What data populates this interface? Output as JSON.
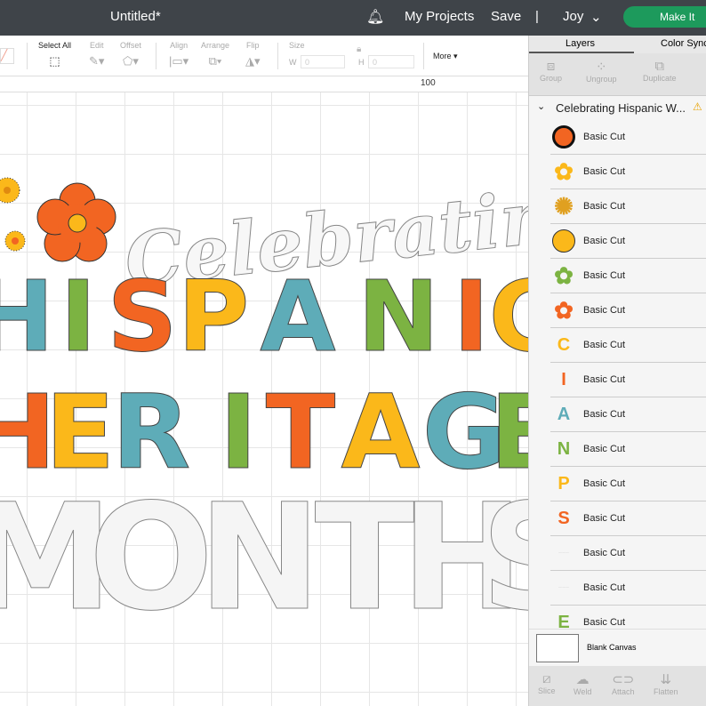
{
  "header": {
    "title": "Untitled*",
    "my_projects": "My Projects",
    "save": "Save",
    "divider": "|",
    "user": "Joy",
    "make_it": "Make It"
  },
  "toolbar": {
    "select_all": "Select All",
    "edit": "Edit",
    "offset": "Offset",
    "align": "Align",
    "arrange": "Arrange",
    "flip": "Flip",
    "size": "Size",
    "w_label": "W",
    "w_value": "0",
    "h_label": "H",
    "h_value": "0",
    "more": "More ▾"
  },
  "ruler": {
    "mark": "100"
  },
  "design": {
    "line1": "Celebrating",
    "line2": [
      "H",
      "I",
      "S",
      "P",
      "A",
      "N",
      "I",
      "C"
    ],
    "line3": [
      "H",
      "E",
      "R",
      "I",
      "T",
      "A",
      "G",
      "E"
    ],
    "line4": [
      "M",
      "O",
      "N",
      "T",
      "H",
      "S"
    ]
  },
  "panel": {
    "tabs": [
      "Layers",
      "Color Sync"
    ],
    "tools": [
      "Group",
      "Ungroup",
      "Duplicate"
    ],
    "group_name": "Celebrating Hispanic W...",
    "layers": [
      {
        "label": "Basic Cut",
        "thumb": "circle-orange",
        "color": "#f26522"
      },
      {
        "label": "Basic Cut",
        "thumb": "flower-yellow",
        "color": "#fbb81a"
      },
      {
        "label": "Basic Cut",
        "thumb": "sun",
        "color": "#e0a020"
      },
      {
        "label": "Basic Cut",
        "thumb": "circle-yellow",
        "color": "#fbb81a"
      },
      {
        "label": "Basic Cut",
        "thumb": "flower-green",
        "color": "#7cb342"
      },
      {
        "label": "Basic Cut",
        "thumb": "flower-orange",
        "color": "#f26522"
      },
      {
        "label": "Basic Cut",
        "thumb": "C",
        "color": "#fbb81a"
      },
      {
        "label": "Basic Cut",
        "thumb": "I",
        "color": "#f26522"
      },
      {
        "label": "Basic Cut",
        "thumb": "A",
        "color": "#5eacb8"
      },
      {
        "label": "Basic Cut",
        "thumb": "N",
        "color": "#7cb342"
      },
      {
        "label": "Basic Cut",
        "thumb": "P",
        "color": "#fbb81a"
      },
      {
        "label": "Basic Cut",
        "thumb": "S",
        "color": "#f26522"
      },
      {
        "label": "Basic Cut",
        "thumb": "faint",
        "color": "#dddddd"
      },
      {
        "label": "Basic Cut",
        "thumb": "faint",
        "color": "#dddddd"
      },
      {
        "label": "Basic Cut",
        "thumb": "E",
        "color": "#7cb342"
      }
    ],
    "blank_canvas": "Blank Canvas",
    "bottom_tools": [
      "Slice",
      "Weld",
      "Attach",
      "Flatten"
    ]
  },
  "colors": {
    "orange": "#f26522",
    "yellow": "#fbb81a",
    "teal": "#5eacb8",
    "green": "#7cb342",
    "accent": "#1d9a5c"
  }
}
